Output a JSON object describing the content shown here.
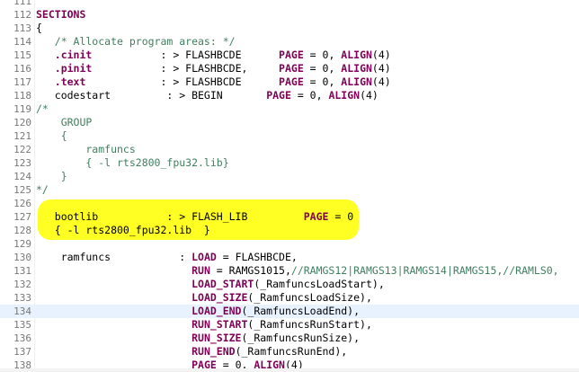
{
  "editor": {
    "highlight_color": "#ffff24",
    "current_line_color": "#e8f2fe",
    "colors": {
      "keyword": "#7f0055",
      "comment": "#3f7f5f",
      "line_number": "#787878"
    },
    "lines": [
      {
        "n": "111",
        "parts": []
      },
      {
        "n": "112",
        "parts": [
          {
            "t": "SECTIONS",
            "c": "kw"
          }
        ]
      },
      {
        "n": "113",
        "parts": [
          {
            "t": "{",
            "c": "pl"
          }
        ]
      },
      {
        "n": "114",
        "parts": [
          {
            "t": "   /* Allocate program areas: */",
            "c": "cm"
          }
        ]
      },
      {
        "n": "115",
        "parts": [
          {
            "t": "   ",
            "c": "pl"
          },
          {
            "t": ".cinit",
            "c": "kw"
          },
          {
            "t": "           : > FLASHBCDE      ",
            "c": "pl"
          },
          {
            "t": "PAGE",
            "c": "kw"
          },
          {
            "t": " = 0, ",
            "c": "pl"
          },
          {
            "t": "ALIGN",
            "c": "kw"
          },
          {
            "t": "(4)",
            "c": "pl"
          }
        ]
      },
      {
        "n": "116",
        "parts": [
          {
            "t": "   ",
            "c": "pl"
          },
          {
            "t": ".pinit",
            "c": "kw"
          },
          {
            "t": "           : > FLASHBCDE,     ",
            "c": "pl"
          },
          {
            "t": "PAGE",
            "c": "kw"
          },
          {
            "t": " = 0, ",
            "c": "pl"
          },
          {
            "t": "ALIGN",
            "c": "kw"
          },
          {
            "t": "(4)",
            "c": "pl"
          }
        ]
      },
      {
        "n": "117",
        "parts": [
          {
            "t": "   ",
            "c": "pl"
          },
          {
            "t": ".text",
            "c": "kw"
          },
          {
            "t": "            : > FLASHBCDE      ",
            "c": "pl"
          },
          {
            "t": "PAGE",
            "c": "kw"
          },
          {
            "t": " = 0, ",
            "c": "pl"
          },
          {
            "t": "ALIGN",
            "c": "kw"
          },
          {
            "t": "(4)",
            "c": "pl"
          }
        ]
      },
      {
        "n": "118",
        "parts": [
          {
            "t": "   codestart         : > BEGIN       ",
            "c": "pl"
          },
          {
            "t": "PAGE",
            "c": "kw"
          },
          {
            "t": " = 0, ",
            "c": "pl"
          },
          {
            "t": "ALIGN",
            "c": "kw"
          },
          {
            "t": "(4)",
            "c": "pl"
          }
        ]
      },
      {
        "n": "119",
        "parts": [
          {
            "t": "/*",
            "c": "cm"
          }
        ]
      },
      {
        "n": "120",
        "parts": [
          {
            "t": "    GROUP",
            "c": "cm"
          }
        ]
      },
      {
        "n": "121",
        "parts": [
          {
            "t": "    {",
            "c": "cm"
          }
        ]
      },
      {
        "n": "122",
        "parts": [
          {
            "t": "        ramfuncs",
            "c": "cm"
          }
        ]
      },
      {
        "n": "123",
        "parts": [
          {
            "t": "        { -l rts2800_fpu32.lib}",
            "c": "cm"
          }
        ]
      },
      {
        "n": "124",
        "parts": [
          {
            "t": "    }",
            "c": "cm"
          }
        ]
      },
      {
        "n": "125",
        "parts": [
          {
            "t": "*/",
            "c": "cm"
          }
        ]
      },
      {
        "n": "126",
        "parts": []
      },
      {
        "n": "127",
        "parts": [
          {
            "t": "   bootlib           : > FLASH_LIB         ",
            "c": "pl"
          },
          {
            "t": "PAGE",
            "c": "kw"
          },
          {
            "t": " = 0",
            "c": "pl"
          }
        ]
      },
      {
        "n": "128",
        "parts": [
          {
            "t": "   { -l rts2800_fpu32.lib  }",
            "c": "pl"
          }
        ]
      },
      {
        "n": "129",
        "parts": []
      },
      {
        "n": "130",
        "parts": [
          {
            "t": "    ramfuncs           : ",
            "c": "pl"
          },
          {
            "t": "LOAD",
            "c": "kw"
          },
          {
            "t": " = FLASHBCDE,",
            "c": "pl"
          }
        ]
      },
      {
        "n": "131",
        "parts": [
          {
            "t": "                         ",
            "c": "pl"
          },
          {
            "t": "RUN",
            "c": "kw"
          },
          {
            "t": " = RAMGS1015,",
            "c": "pl"
          },
          {
            "t": "//RAMGS12|RAMGS13|RAMGS14|RAMGS15,//RAMLS0,",
            "c": "cm"
          }
        ]
      },
      {
        "n": "132",
        "parts": [
          {
            "t": "                         ",
            "c": "pl"
          },
          {
            "t": "LOAD_START",
            "c": "kw"
          },
          {
            "t": "(_RamfuncsLoadStart),",
            "c": "pl"
          }
        ]
      },
      {
        "n": "133",
        "parts": [
          {
            "t": "                         ",
            "c": "pl"
          },
          {
            "t": "LOAD_SIZE",
            "c": "kw"
          },
          {
            "t": "(_RamfuncsLoadSize),",
            "c": "pl"
          }
        ]
      },
      {
        "n": "134",
        "current": true,
        "parts": [
          {
            "t": "                         ",
            "c": "pl"
          },
          {
            "t": "LOAD_END",
            "c": "kw"
          },
          {
            "t": "(_RamfuncsLoadEnd),",
            "c": "pl"
          }
        ]
      },
      {
        "n": "135",
        "parts": [
          {
            "t": "                         ",
            "c": "pl"
          },
          {
            "t": "RUN_START",
            "c": "kw"
          },
          {
            "t": "(_RamfuncsRunStart),",
            "c": "pl"
          }
        ]
      },
      {
        "n": "136",
        "parts": [
          {
            "t": "                         ",
            "c": "pl"
          },
          {
            "t": "RUN_SIZE",
            "c": "kw"
          },
          {
            "t": "(_RamfuncsRunSize),",
            "c": "pl"
          }
        ]
      },
      {
        "n": "137",
        "parts": [
          {
            "t": "                         ",
            "c": "pl"
          },
          {
            "t": "RUN_END",
            "c": "kw"
          },
          {
            "t": "(_RamfuncsRunEnd),",
            "c": "pl"
          }
        ]
      },
      {
        "n": "138",
        "parts": [
          {
            "t": "                         ",
            "c": "pl"
          },
          {
            "t": "PAGE",
            "c": "kw"
          },
          {
            "t": " = 0, ",
            "c": "pl"
          },
          {
            "t": "ALIGN",
            "c": "kw"
          },
          {
            "t": "(4)",
            "c": "pl"
          }
        ]
      }
    ]
  }
}
